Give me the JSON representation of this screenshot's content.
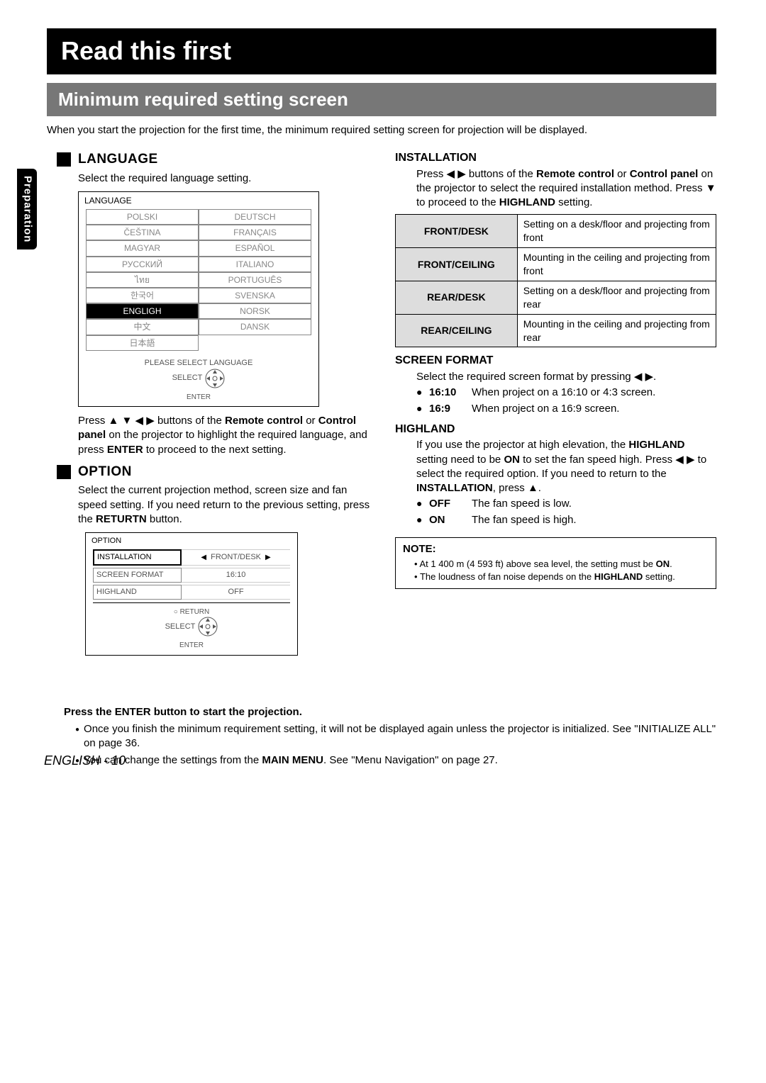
{
  "title": "Read this first",
  "subtitle": "Minimum required setting screen",
  "side_tab": "Preparation",
  "intro": "When you start the projection for the first time, the minimum required setting screen for projection will be displayed.",
  "language": {
    "heading": "LANGUAGE",
    "desc": "Select the required language setting.",
    "box_title": "LANGUAGE",
    "items_left": [
      "POLSKI",
      "ČEŠTINA",
      "MAGYAR",
      "РУССКИЙ",
      "ไทย",
      "한국어",
      "ENGLIGH",
      "中文",
      "日本語"
    ],
    "items_right": [
      "DEUTSCH",
      "FRANÇAIS",
      "ESPAÑOL",
      "ITALIANO",
      "PORTUGUÊS",
      "SVENSKA",
      "NORSK",
      "DANSK"
    ],
    "selected": "ENGLIGH",
    "please": "PLEASE SELECT LANGUAGE",
    "select_label": "SELECT",
    "enter_label": "ENTER",
    "press_text_1": "Press ▲ ▼ ◀ ▶ buttons of the ",
    "press_bold_1": "Remote control",
    "press_text_2": " or ",
    "press_bold_2": "Control panel",
    "press_text_3": " on the projector to highlight the required language, and press ",
    "press_bold_3": "ENTER",
    "press_text_4": " to proceed to the next setting."
  },
  "option": {
    "heading": "OPTION",
    "desc_1": "Select the current projection method, screen size and fan speed setting. If you need return to the previous setting, press the ",
    "desc_bold": "RETURTN",
    "desc_2": " button.",
    "box_title": "OPTION",
    "rows": [
      {
        "label": "INSTALLATION",
        "value": "FRONT/DESK",
        "sel": true,
        "arrows": true
      },
      {
        "label": "SCREEN FORMAT",
        "value": "16:10"
      },
      {
        "label": "HIGHLAND",
        "value": "OFF"
      }
    ],
    "return_label": "RETURN",
    "select_label": "SELECT",
    "enter_label": "ENTER"
  },
  "installation": {
    "heading": "INSTALLATION",
    "body_1": "Press ◀ ▶ buttons of the ",
    "b1": "Remote control",
    "body_2": " or ",
    "b2": "Control panel",
    "body_3": " on the projector to select the required installation method. Press ▼ to proceed to the ",
    "b3": "HIGHLAND",
    "body_4": " setting.",
    "table": [
      {
        "k": "FRONT/DESK",
        "v": "Setting on a desk/floor and projecting from front"
      },
      {
        "k": "FRONT/CEILING",
        "v": "Mounting in the ceiling and projecting from front"
      },
      {
        "k": "REAR/DESK",
        "v": "Setting on a desk/floor and projecting from rear"
      },
      {
        "k": "REAR/CEILING",
        "v": "Mounting in the ceiling and projecting from rear"
      }
    ]
  },
  "screen_format": {
    "heading": "SCREEN FORMAT",
    "desc": "Select the required screen format by pressing ◀ ▶.",
    "items": [
      {
        "k": "16:10",
        "v": "When project on a 16:10 or 4:3 screen."
      },
      {
        "k": "16:9",
        "v": "When project on a 16:9 screen."
      }
    ]
  },
  "highland": {
    "heading": "HIGHLAND",
    "body_1": "If you use the projector at high elevation, the ",
    "b1": "HIGHLAND",
    "body_2": " setting need to be ",
    "b2": "ON",
    "body_3": " to set the fan speed high. Press ◀ ▶ to select the required option. If you need to return to the ",
    "b3": "INSTALLATION",
    "body_4": ", press ▲.",
    "items": [
      {
        "k": "OFF",
        "v": "The fan speed is low."
      },
      {
        "k": "ON",
        "v": "The fan speed is high."
      }
    ]
  },
  "note": {
    "heading": "NOTE:",
    "items": [
      "At 1 400 m (4 593 ft) above sea level, the setting must be ON.",
      "The loudness of fan noise depends on the HIGHLAND setting."
    ],
    "item1_pre": "At 1 400 m (4 593 ft) above sea level, the setting must be ",
    "item1_b": "ON",
    "item1_post": ".",
    "item2_pre": "The loudness of fan noise depends on the ",
    "item2_b": "HIGHLAND",
    "item2_post": " setting."
  },
  "bottom": {
    "lead": "Press the ENTER button to start the projection.",
    "li1a": "Once you finish the minimum requirement setting, it will not be displayed again unless the projector is initialized. See \"INITIALIZE ALL\" on page 36.",
    "li2a": "You can change the settings from the ",
    "li2b": "MAIN MENU",
    "li2c": ". See \"Menu Navigation\" on page 27."
  },
  "footer": {
    "lang": "ENGLISH",
    "sep": " - ",
    "page": "10"
  }
}
